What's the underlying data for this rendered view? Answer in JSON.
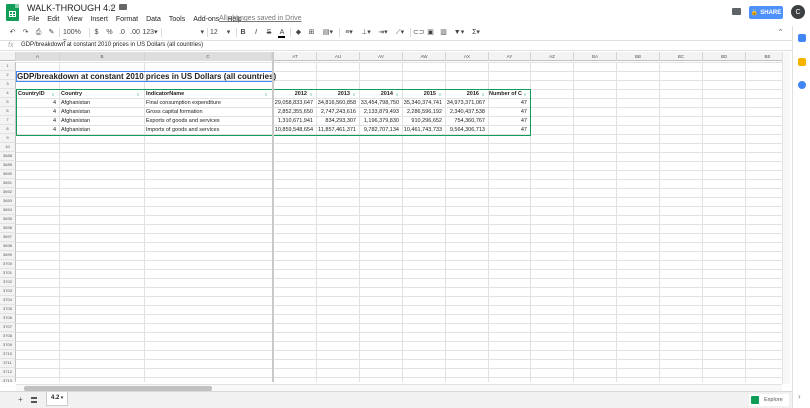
{
  "header": {
    "title": "WALK-THROUGH 4.2",
    "saved_status": "All changes saved in Drive",
    "share_label": "SHARE",
    "avatar_initial": "C",
    "menu": [
      "File",
      "Edit",
      "View",
      "Insert",
      "Format",
      "Data",
      "Tools",
      "Add-ons",
      "Help"
    ]
  },
  "toolbar": {
    "zoom": "100%",
    "currency": "$",
    "percent": "%",
    "decimal_less": ".0",
    "decimal_more": ".00",
    "more_formats": "123",
    "font_size": "12",
    "bold": "B",
    "italic": "I",
    "strike": "S",
    "text_color": "A",
    "function": "Σ"
  },
  "formula_bar": {
    "fx": "fx",
    "value": "GDP/breakdown at constant 2010 prices in US Dollars (all countries)"
  },
  "grid": {
    "columns": [
      "A",
      "B",
      "C",
      "AT",
      "AU",
      "AV",
      "AW",
      "AX",
      "AY",
      "AZ",
      "BA",
      "BB",
      "BC",
      "BD",
      "BE"
    ],
    "row_numbers": [
      "1",
      "2",
      "3",
      "4",
      "5",
      "6",
      "7",
      "8",
      "9",
      "10",
      "3688",
      "3689",
      "3690",
      "3691",
      "3692",
      "3693",
      "3694",
      "3695",
      "3696",
      "3697",
      "3698",
      "3699",
      "3700",
      "3701",
      "3702",
      "3703",
      "3704",
      "3705",
      "3706",
      "3707",
      "3708",
      "3709",
      "3710",
      "3711",
      "3712",
      "3713",
      "3714",
      "3715",
      "3716"
    ],
    "title": "GDP/breakdown at constant 2010 prices in US Dollars (all countries)",
    "headers": [
      "CountryID",
      "Country",
      "IndicatorName",
      "2012",
      "2013",
      "2014",
      "2015",
      "2016",
      "Number of Co"
    ],
    "rows": [
      [
        "4",
        "Afghanistan",
        "Final consumption expenditure",
        "29,058,833,647",
        "34,816,560,858",
        "33,454,798,750",
        "35,340,374,741",
        "34,973,371,067",
        "47"
      ],
      [
        "4",
        "Afghanistan",
        "Gross capital formation",
        "2,852,355,650",
        "2,747,243,616",
        "2,133,879,493",
        "2,286,596,192",
        "2,340,437,538",
        "47"
      ],
      [
        "4",
        "Afghanistan",
        "Exports of goods and services",
        "1,310,671,941",
        "834,293,307",
        "1,196,379,830",
        "910,296,652",
        "754,360,767",
        "47"
      ],
      [
        "4",
        "Afghanistan",
        "Imports of goods and services",
        "10,859,548,654",
        "11,857,461,371",
        "9,782,707,134",
        "10,461,743,733",
        "9,564,306,713",
        "47"
      ]
    ]
  },
  "bottom": {
    "add_sheet": "+",
    "sheet_tab": "4.2",
    "explore_label": "Explore"
  }
}
